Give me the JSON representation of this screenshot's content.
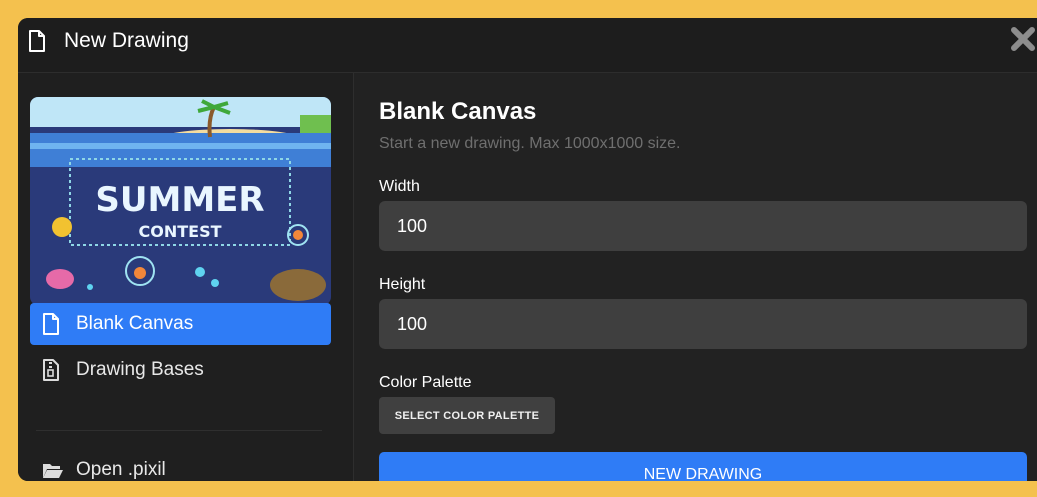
{
  "dialog": {
    "title": "New Drawing",
    "title_icon": "document-icon",
    "close_icon": "close-icon"
  },
  "sidebar": {
    "promo_image": "summer-contest-banner",
    "items": [
      {
        "label": "Blank Canvas",
        "icon": "document-icon",
        "active": true
      },
      {
        "label": "Drawing Bases",
        "icon": "zip-file-icon",
        "active": false
      },
      {
        "label": "Open .pixil",
        "icon": "folder-open-icon",
        "active": false
      }
    ]
  },
  "main": {
    "heading": "Blank Canvas",
    "subtitle": "Start a new drawing. Max 1000x1000 size.",
    "width_label": "Width",
    "width_value": "100",
    "height_label": "Height",
    "height_value": "100",
    "palette_label": "Color Palette",
    "palette_button": "SELECT COLOR PALETTE",
    "new_button": "NEW DRAWING"
  },
  "colors": {
    "accent": "#2f7cf6",
    "frame": "#f4c14e",
    "panel": "#222222"
  }
}
